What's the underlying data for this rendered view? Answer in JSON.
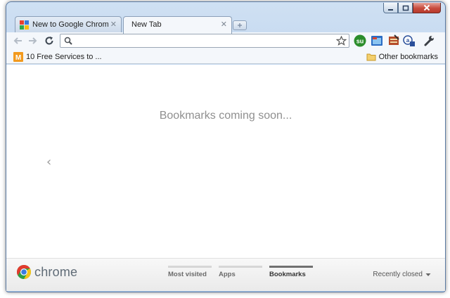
{
  "window": {
    "caption_buttons": [
      "minimize",
      "maximize",
      "close"
    ]
  },
  "tabs": [
    {
      "title": "New to Google Chrome? - G",
      "active": false,
      "icon": "google-favicon"
    },
    {
      "title": "New Tab",
      "active": true,
      "icon": ""
    }
  ],
  "toolbar": {
    "back_icon": "back-arrow-icon",
    "forward_icon": "forward-arrow-icon",
    "reload_icon": "reload-icon",
    "omnibox": {
      "value": "",
      "placeholder": ""
    },
    "star_icon": "star-icon",
    "extensions": [
      "stumbleupon-icon",
      "extension-icon-2",
      "extension-icon-3",
      "extension-icon-4"
    ],
    "wrench_icon": "wrench-icon"
  },
  "bookmarks_bar": {
    "items": [
      {
        "label": "10 Free Services to ...",
        "icon": "m-favicon"
      }
    ],
    "other": {
      "label": "Other bookmarks",
      "icon": "folder-icon"
    }
  },
  "content": {
    "message": "Bookmarks coming soon...",
    "prev_arrow": "‹"
  },
  "footer": {
    "logo_text": "chrome",
    "tabs": [
      {
        "label": "Most visited",
        "selected": false
      },
      {
        "label": "Apps",
        "selected": false
      },
      {
        "label": "Bookmarks",
        "selected": true
      }
    ],
    "recently_closed": "Recently closed"
  },
  "colors": {
    "frame": "#b9d1ec",
    "toolbar": "#f4f7fb",
    "message_text": "#8f8f8f",
    "selected_tab_bar": "#707070"
  }
}
